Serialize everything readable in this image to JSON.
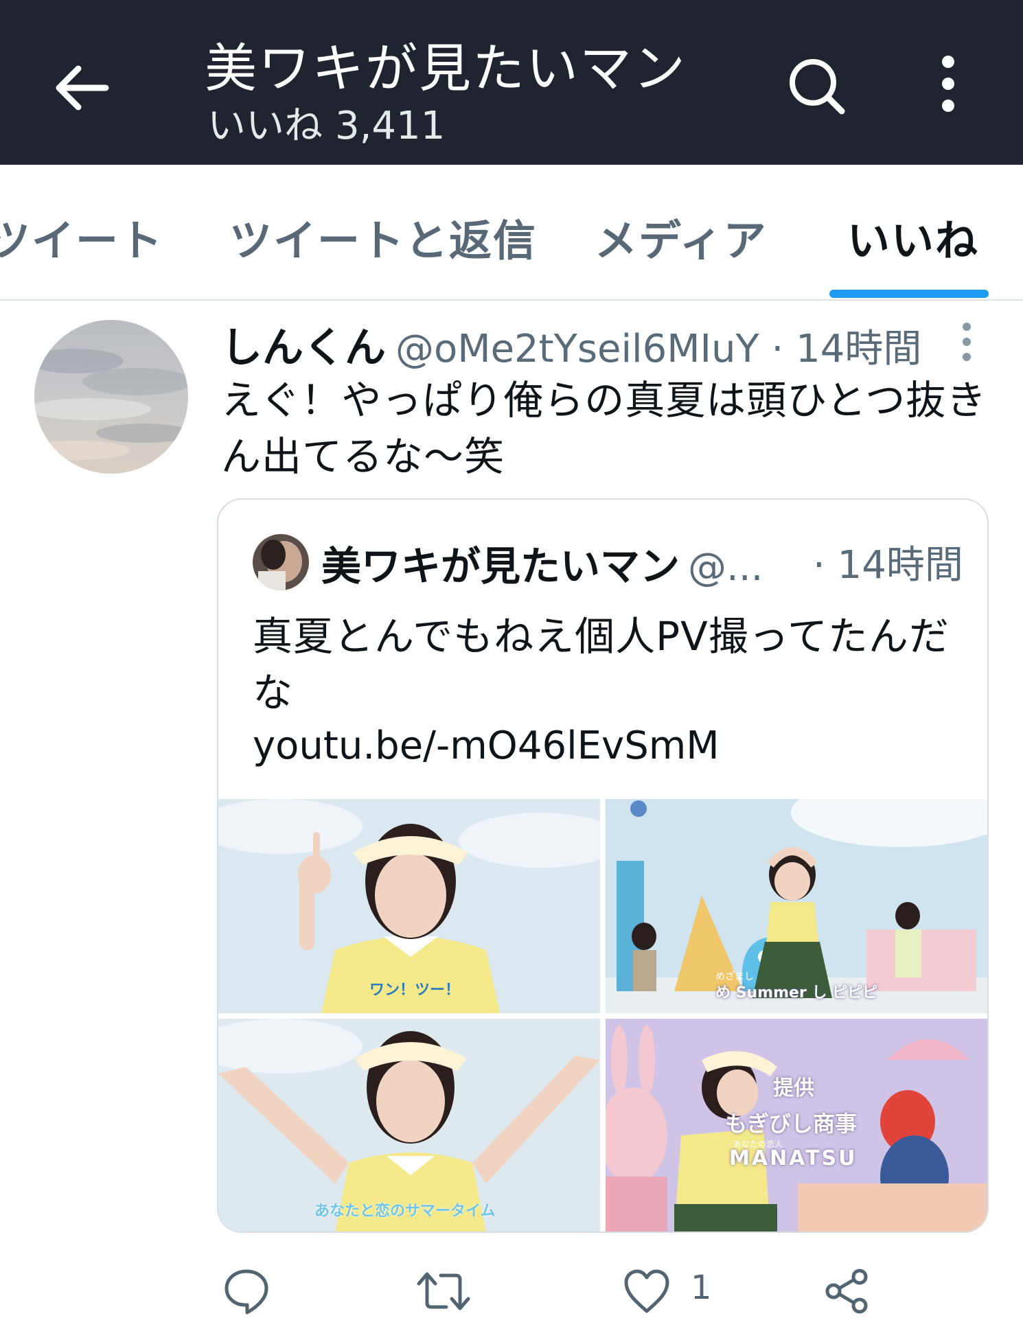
{
  "header": {
    "title": "美ワキが見たいマン",
    "subtitle_label": "いいね",
    "subtitle_count": "3,411",
    "back_icon": "arrow-left-icon",
    "search_icon": "search-icon",
    "more_icon": "more-vertical-icon",
    "background": "#1f2430"
  },
  "tabs": {
    "items": [
      {
        "label": "ツイート"
      },
      {
        "label": "ツイートと返信"
      },
      {
        "label": "メディア"
      },
      {
        "label": "いいね"
      }
    ],
    "active_index": 3,
    "accent": "#1d9bf0"
  },
  "tweet": {
    "author_name": "しんくん",
    "author_handle": "@oMe2tYseil6MIuY",
    "time": "· 14時間",
    "text": "えぐ！やっぱり俺らの真夏は頭ひとつ抜きん出てるな〜笑",
    "quote": {
      "author_name": "美ワキが見たいマン",
      "author_handle": "@...",
      "time": "· 14時間",
      "text": "真夏とんでもねえ個人PV撮ってたんだな",
      "link": "youtu.be/-mO46lEvSmM",
      "media": [
        {
          "caption": "ワン！ツー！"
        },
        {
          "caption_small": "めざまし",
          "caption": "め Summer し ピピピ"
        },
        {
          "caption": "あなたと恋のサマータイム"
        },
        {
          "caption_top": "提供",
          "caption_mid": "もぎびし商事",
          "caption_small": "あなたの恋人",
          "caption_bottom": "MANATSU"
        }
      ]
    },
    "actions": {
      "reply_icon": "reply-icon",
      "retweet_icon": "retweet-icon",
      "like_icon": "heart-icon",
      "like_count": "1",
      "share_icon": "share-icon"
    }
  }
}
